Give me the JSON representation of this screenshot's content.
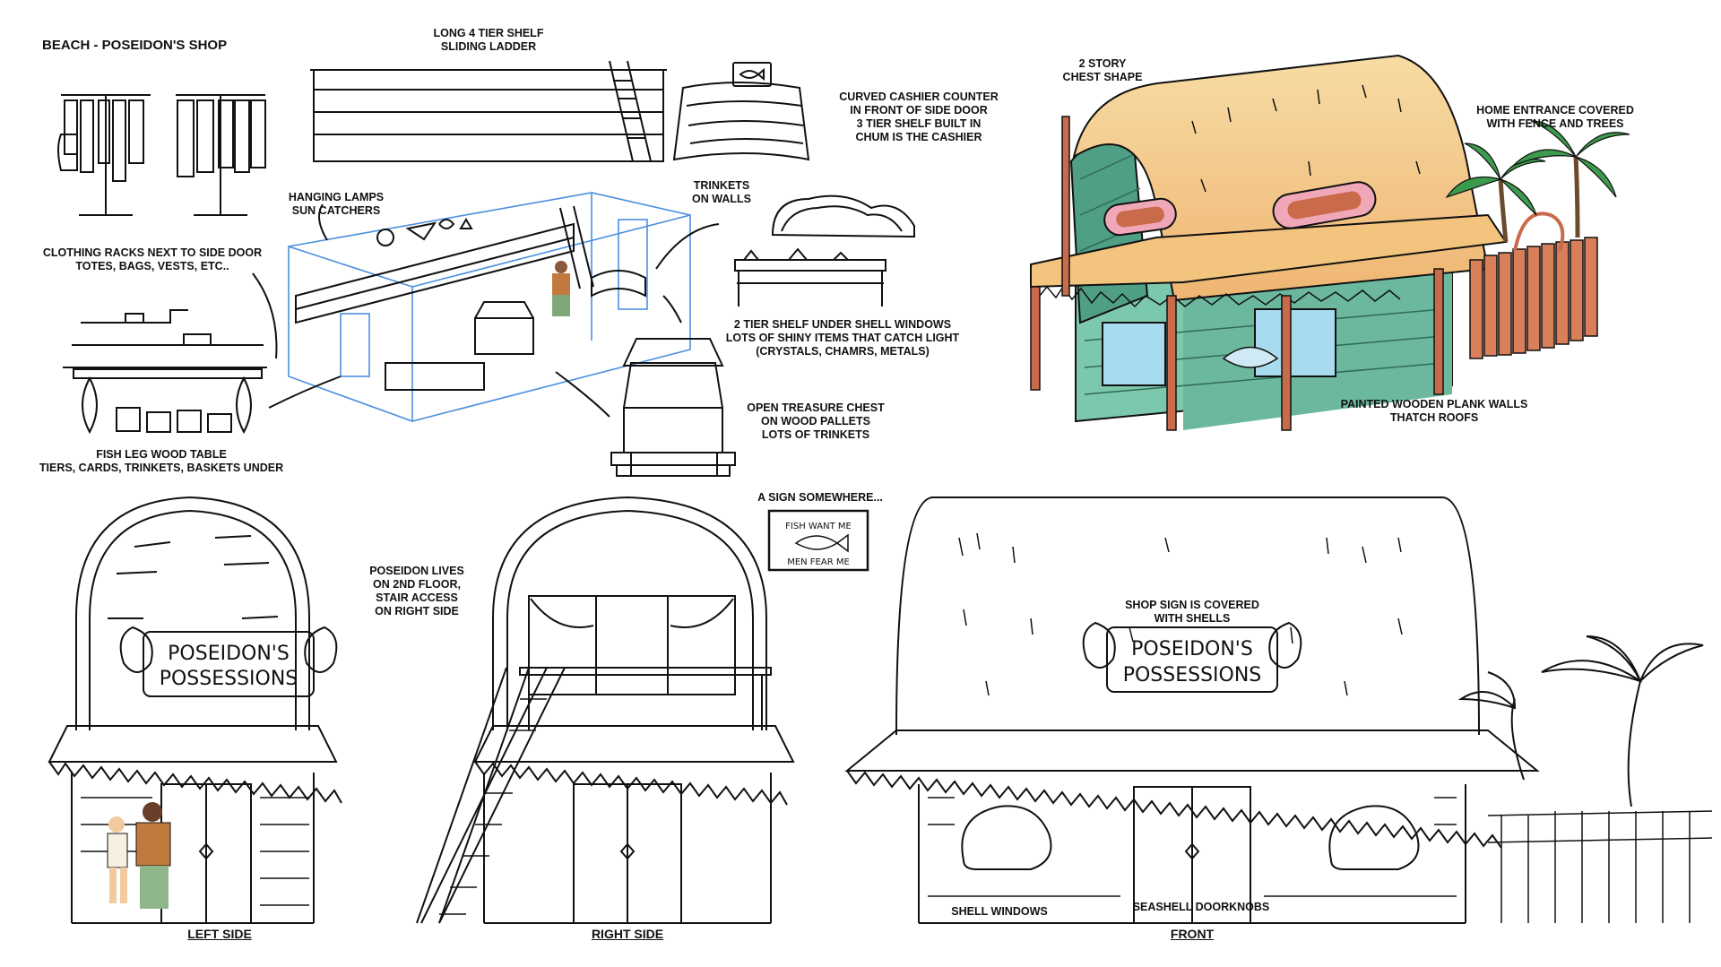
{
  "page": {
    "title": "BEACH - POSEIDON'S SHOP"
  },
  "labels": {
    "shelf_long_1": "LONG  4 TIER SHELF",
    "shelf_long_2": "SLIDING LADDER",
    "cashier_1": "CURVED CASHIER COUNTER",
    "cashier_2": "IN FRONT OF SIDE DOOR",
    "cashier_3": "3 TIER SHELF BUILT IN",
    "cashier_4": "CHUM IS THE CASHIER",
    "lamps_1": "HANGING LAMPS",
    "lamps_2": "SUN CATCHERS",
    "trinkets_1": "TRINKETS",
    "trinkets_2": "ON WALLS",
    "racks_1": "CLOTHING RACKS NEXT TO SIDE DOOR",
    "racks_2": "TOTES, BAGS, VESTS, ETC..",
    "shelf2_1": "2 TIER SHELF UNDER SHELL WINDOWS",
    "shelf2_2": "LOTS OF SHINY ITEMS THAT CATCH LIGHT",
    "shelf2_3": "(CRYSTALS, CHAMRS, METALS)",
    "chest_1": "OPEN TREASURE CHEST",
    "chest_2": "ON WOOD PALLETS",
    "chest_3": "LOTS OF TRINKETS",
    "table_1": "FISH LEG WOOD TABLE",
    "table_2": "TIERS, CARDS, TRINKETS, BASKETS UNDER",
    "story_1": "2 STORY",
    "story_2": "CHEST SHAPE",
    "home_1": "HOME ENTRANCE COVERED",
    "home_2": "WITH FENCE AND TREES",
    "walls_1": "PAINTED WOODEN PLANK WALLS",
    "walls_2": "THATCH ROOFS",
    "sign_somewhere": "A SIGN SOMEWHERE...",
    "lives_1": "POSEIDON LIVES",
    "lives_2": "ON 2ND FLOOR,",
    "lives_3": "STAIR ACCESS",
    "lives_4": "ON RIGHT SIDE",
    "shopsign_1": "SHOP SIGN IS COVERED",
    "shopsign_2": "WITH SHELLS",
    "shell_windows": "SHELL WINDOWS",
    "doorknobs": "SEASHELL DOORKNOBS"
  },
  "views": {
    "left": "LEFT SIDE",
    "right": "RIGHT SIDE",
    "front": "FRONT"
  },
  "signs": {
    "shop_line1": "POSEIDON'S",
    "shop_line2": "POSSESSIONS",
    "fish_line1": "FISH WANT ME",
    "fish_line2": "MEN FEAR ME",
    "cashier_sign": "CHUM"
  },
  "colors": {
    "thatch": "#f2c47e",
    "thatch_light": "#f7dca4",
    "wall_green": "#7cc8ad",
    "wall_dark": "#4f9e86",
    "post_brown": "#c96a4a",
    "sign_pink": "#f0a7b8",
    "window_blue": "#a9dbf0",
    "palm_green": "#3c9a4c",
    "fence": "#d97f5a",
    "blueprint": "#4a8fe0"
  }
}
